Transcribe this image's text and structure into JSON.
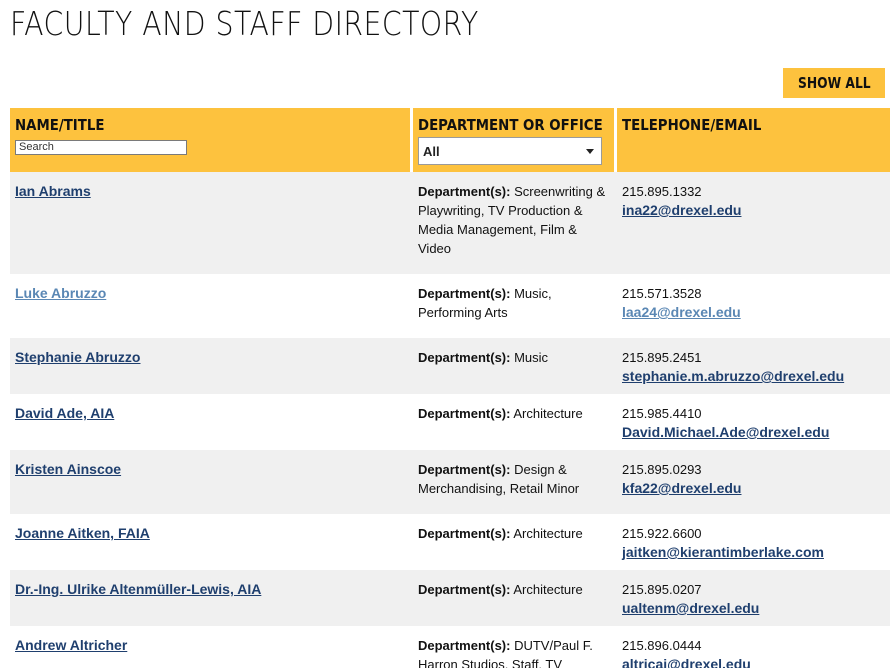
{
  "page": {
    "title": "FACULTY AND STAFF DIRECTORY",
    "show_all_label": "SHOW ALL"
  },
  "table": {
    "columns": {
      "name": "NAME/TITLE",
      "department": "DEPARTMENT OR OFFICE",
      "contact": "TELEPHONE/EMAIL"
    },
    "search_placeholder": "Search",
    "department_selected": "All",
    "dept_prefix": "Department(s):",
    "rows": [
      {
        "name": "Ian Abrams ",
        "departments": " Screenwriting & Playwriting, TV Production & Media Management, Film & Video",
        "phone": "215.895.1332",
        "email": "ina22@drexel.edu"
      },
      {
        "name": "Luke Abruzzo",
        "departments": " Music, Performing Arts",
        "phone": "215.571.3528",
        "email": "laa24@drexel.edu"
      },
      {
        "name": "Stephanie Abruzzo",
        "departments": " Music",
        "phone": "215.895.2451",
        "email": "stephanie.m.abruzzo@drexel.edu"
      },
      {
        "name": "David Ade, AIA",
        "departments": " Architecture",
        "phone": "215.985.4410",
        "email": "David.Michael.Ade@drexel.edu"
      },
      {
        "name": "Kristen Ainscoe",
        "departments": " Design & Merchandising, Retail Minor",
        "phone": "215.895.0293",
        "email": "kfa22@drexel.edu"
      },
      {
        "name": "Joanne Aitken, FAIA",
        "departments": " Architecture",
        "phone": "215.922.6600",
        "email": "jaitken@kierantimberlake.com"
      },
      {
        "name": "Dr.-Ing. Ulrike Altenmüller-Lewis, AIA",
        "departments": " Architecture",
        "phone": "215.895.0207",
        "email": "ualtenm@drexel.edu"
      },
      {
        "name": "Andrew Altricher",
        "departments": " DUTV/Paul F. Harron Studios, Staff, TV",
        "phone": "215.896.0444",
        "email": "altricaj@drexel.edu"
      }
    ]
  },
  "colors": {
    "accent": "#fdc23e",
    "link": "#1f3f6e",
    "link_visited": "#5a87b4",
    "row_alt": "#f0f0f0"
  }
}
